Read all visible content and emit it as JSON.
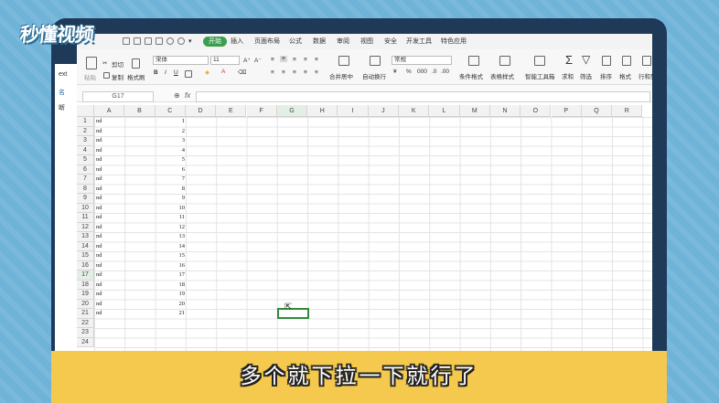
{
  "logo": {
    "text": "秒懂视频"
  },
  "left_strip": {
    "items": [
      "ext",
      "名",
      "断"
    ]
  },
  "menu_tabs": [
    {
      "label": "开始",
      "active": true
    },
    {
      "label": "插入"
    },
    {
      "label": "页面布局"
    },
    {
      "label": "公式"
    },
    {
      "label": "数据"
    },
    {
      "label": "审阅"
    },
    {
      "label": "视图"
    },
    {
      "label": "安全"
    },
    {
      "label": "开发工具"
    },
    {
      "label": "特色应用"
    }
  ],
  "ribbon": {
    "paste_label": "粘贴",
    "cut_label": "剪切",
    "copy_label": "复制",
    "format_painter_label": "格式刷",
    "font_name": "宋体",
    "font_size": "11",
    "merge_label": "合并居中",
    "wrap_label": "自动换行",
    "number_format": "常规",
    "conditional_label": "条件格式",
    "table_style_label": "表格样式",
    "smart_toolbox_label": "智能工具箱",
    "sum_label": "求和",
    "filter_label": "筛选",
    "sort_label": "排序",
    "format_label": "格式",
    "rowcol_label": "行和列"
  },
  "formula_bar": {
    "name_box": "G17",
    "fx_label": "fx"
  },
  "columns": [
    "A",
    "B",
    "C",
    "D",
    "E",
    "F",
    "G",
    "H",
    "I",
    "J",
    "K",
    "L",
    "M",
    "N",
    "O",
    "P",
    "Q",
    "R"
  ],
  "rows": [
    "1",
    "2",
    "3",
    "4",
    "5",
    "6",
    "7",
    "8",
    "9",
    "10",
    "11",
    "12",
    "13",
    "14",
    "15",
    "16",
    "17",
    "18",
    "19",
    "20",
    "21",
    "22",
    "23",
    "24"
  ],
  "col_a_values": [
    "nd",
    "nd",
    "nd",
    "nd",
    "nd",
    "nd",
    "nd",
    "nd",
    "nd",
    "nd",
    "nd",
    "nd",
    "nd",
    "nd",
    "nd",
    "nd",
    "nd",
    "nd",
    "nd",
    "nd",
    "nd"
  ],
  "col_c_values": [
    "1",
    "2",
    "3",
    "4",
    "5",
    "6",
    "7",
    "8",
    "9",
    "10",
    "11",
    "12",
    "13",
    "14",
    "15",
    "16",
    "17",
    "18",
    "19",
    "20",
    "21"
  ],
  "autofill_icon_label": "昆",
  "subtitle": "多个就下拉一下就行了",
  "colors": {
    "accent": "#3a9e4f",
    "subtitle_bar": "#f5c94d",
    "frame": "#1f3a58",
    "background": "#6fb3d8"
  }
}
